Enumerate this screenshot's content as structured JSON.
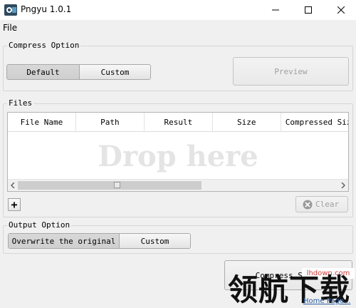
{
  "window": {
    "title": "Pngyu 1.0.1"
  },
  "menu": {
    "file": "File"
  },
  "compress_option": {
    "title": "Compress Option",
    "default_label": "Default",
    "custom_label": "Custom",
    "preview_label": "Preview"
  },
  "files": {
    "title": "Files",
    "columns": [
      "File Name",
      "Path",
      "Result",
      "Size",
      "Compressed Size"
    ],
    "drop_hint": "Drop here",
    "add_label": "+",
    "clear_label": "Clear"
  },
  "output_option": {
    "title": "Output Option",
    "overwrite_label": "Overwrite the original",
    "custom_label": "Custom"
  },
  "compress_button": {
    "label": "Compress Start"
  },
  "watermark": {
    "site": "lhdown.com",
    "text": "领航下载",
    "home_link": "Home Page..."
  },
  "colors": {
    "clear_icon": "#9a9a9a",
    "close_icon": "#000000"
  }
}
